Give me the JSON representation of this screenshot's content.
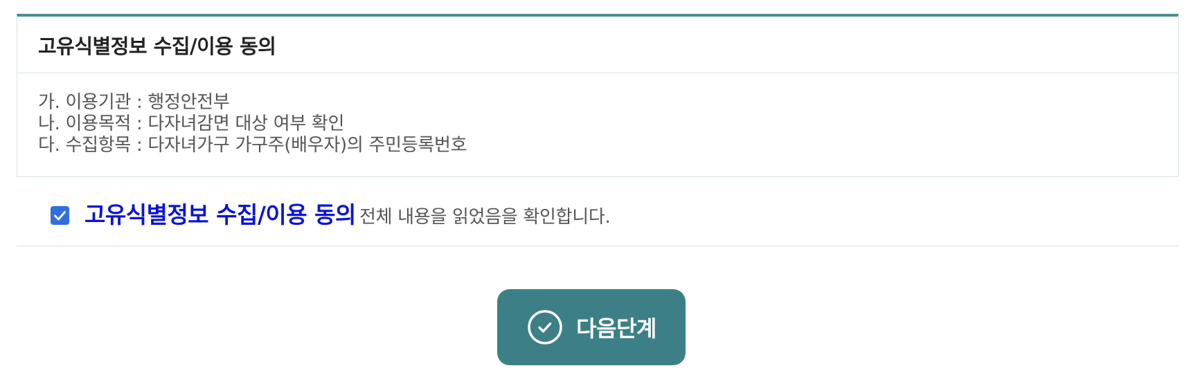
{
  "consent": {
    "title": "고유식별정보 수집/이용 동의",
    "lines": [
      "가. 이용기관 : 행정안전부",
      "나. 이용목적 : 다자녀감면 대상 여부 확인",
      "다. 수집항목 : 다자녀가구 가구주(배우자)의 주민등록번호"
    ]
  },
  "agreement": {
    "checked": true,
    "title": "고유식별정보 수집/이용 동의",
    "description": "전체 내용을 읽었음을 확인합니다."
  },
  "next_button": {
    "label": "다음단계",
    "icon": "check-circle-icon"
  },
  "colors": {
    "accent": "#3d7f86",
    "border_top": "#4a8c92",
    "agree_title": "#0a14d6",
    "checkbox": "#2f6fe0"
  }
}
